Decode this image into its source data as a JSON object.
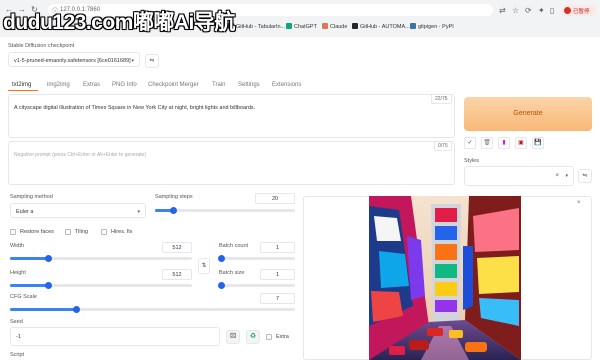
{
  "browser": {
    "url": "127.0.0.1:7860",
    "profile_label": "已暂停",
    "bookmarks": [
      "GitHub - TabularIn...",
      "ChatGPT",
      "Claude",
      "GitHub - AUTOMA...",
      "gitpigen · PyPI"
    ],
    "watermark": "dudu123.com嘟嘟Ai导航"
  },
  "webui": {
    "checkpoint_label": "Stable Diffusion checkpoint",
    "checkpoint_value": "v1-5-pruned-emaonly.safetensors [6ce0161689]",
    "tabs": [
      "txt2img",
      "img2img",
      "Extras",
      "PNG Info",
      "Checkpoint Merger",
      "Train",
      "Settings",
      "Extensions"
    ],
    "active_tab": "txt2img",
    "prompt": "A cityscape digital illustration of Times Square in New York City at night, bright lights and billboards.",
    "prompt_counter": "22/75",
    "negative_placeholder": "Negative prompt (press Ctrl+Enter or Alt+Enter to generate)",
    "negative_counter": "0/75",
    "generate_label": "Generate",
    "styles_label": "Styles",
    "style_buttons": [
      "✓",
      "🗑",
      "▮",
      "▣",
      "💾"
    ],
    "sampling_method_label": "Sampling method",
    "sampling_method_value": "Euler a",
    "sampling_steps_label": "Sampling steps",
    "sampling_steps_value": "20",
    "checkboxes": [
      "Restore faces",
      "Tiling",
      "Hires. fix"
    ],
    "width_label": "Width",
    "width_value": "512",
    "height_label": "Height",
    "height_value": "512",
    "batch_count_label": "Batch count",
    "batch_count_value": "1",
    "batch_size_label": "Batch size",
    "batch_size_value": "1",
    "cfg_label": "CFG Scale",
    "cfg_value": "7",
    "seed_label": "Seed",
    "seed_value": "-1",
    "extra_label": "Extra",
    "script_label": "Script",
    "swap_icon": "⇅",
    "dice_icon": "⚄",
    "recycle_icon": "♻"
  },
  "slider_levels": {
    "steps": 0.13,
    "width": 0.21,
    "height": 0.21,
    "batch_count": 0.02,
    "batch_size": 0.02,
    "cfg": 0.23
  },
  "colors": {
    "accent": "#f97316",
    "slider": "#3b82f6",
    "generate_bg": "#f8b877"
  }
}
